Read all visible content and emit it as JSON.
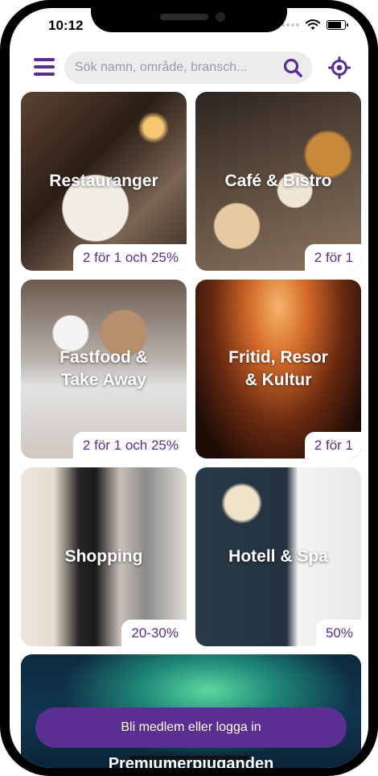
{
  "status_bar": {
    "time": "10:12"
  },
  "search": {
    "placeholder": "Sök namn, område, bransch..."
  },
  "categories": [
    {
      "title": "Restauranger",
      "offer": "2 för 1 och 25%"
    },
    {
      "title": "Café & Bistro",
      "offer": "2 för 1"
    },
    {
      "title": "Fastfood &\nTake Away",
      "offer": "2 för 1 och 25%"
    },
    {
      "title": "Fritid, Resor\n& Kultur",
      "offer": "2 för 1"
    },
    {
      "title": "Shopping",
      "offer": "20-30%"
    },
    {
      "title": "Hotell & Spa",
      "offer": "50%"
    },
    {
      "title": "Premiumerbjudanden"
    }
  ],
  "cta": {
    "label": "Bli medlem eller logga in"
  },
  "colors": {
    "accent": "#5b2f91",
    "search_bg": "#ececef"
  },
  "icons": [
    "menu-icon",
    "search-icon",
    "locate-icon",
    "wifi-icon",
    "battery-icon"
  ]
}
